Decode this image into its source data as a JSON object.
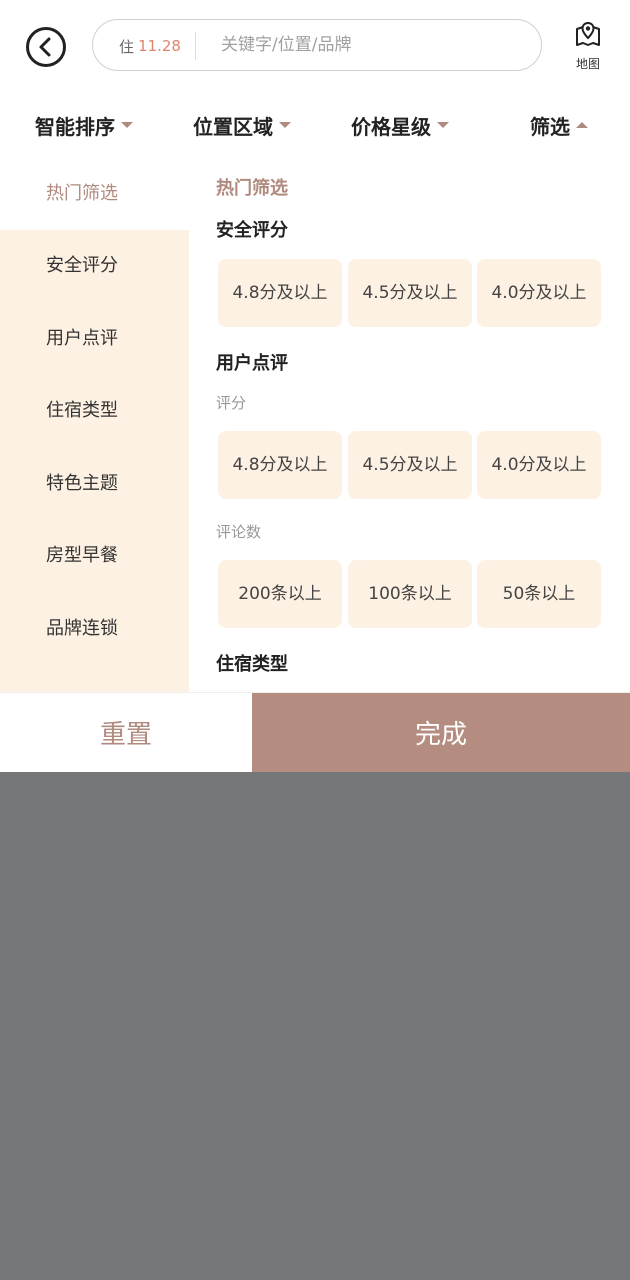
{
  "header": {
    "date_prefix": "住",
    "date_value": "11.28",
    "search_placeholder": "关键字/位置/品牌",
    "map_label": "地图",
    "icons": {
      "back": "back-icon",
      "map": "map-pin-icon"
    }
  },
  "sort_bar": {
    "tabs": [
      {
        "label": "智能排序",
        "caret": "down"
      },
      {
        "label": "位置区域",
        "caret": "down"
      },
      {
        "label": "价格星级",
        "caret": "down"
      },
      {
        "label": "筛选",
        "caret": "up",
        "active": true
      }
    ]
  },
  "left_menu": {
    "items": [
      {
        "label": "热门筛选",
        "active": true
      },
      {
        "label": "安全评分"
      },
      {
        "label": "用户点评"
      },
      {
        "label": "住宿类型"
      },
      {
        "label": "特色主题"
      },
      {
        "label": "房型早餐"
      },
      {
        "label": "品牌连锁"
      }
    ]
  },
  "content": {
    "hot_title": "热门筛选",
    "safety": {
      "title": "安全评分",
      "options": [
        "4.8分及以上",
        "4.5分及以上",
        "4.0分及以上"
      ]
    },
    "reviews": {
      "title": "用户点评",
      "score_label": "评分",
      "score_options": [
        "4.8分及以上",
        "4.5分及以上",
        "4.0分及以上"
      ],
      "count_label": "评论数",
      "count_options": [
        "200条以上",
        "100条以上",
        "50条以上"
      ]
    },
    "lodging": {
      "title": "住宿类型"
    }
  },
  "actions": {
    "reset": "重置",
    "done": "完成"
  },
  "colors": {
    "accent": "#b08a7e",
    "done_button": "#b48d80",
    "chip_bg": "#fdf1e3",
    "overlay": "#767779",
    "date_highlight": "#e0856e"
  }
}
